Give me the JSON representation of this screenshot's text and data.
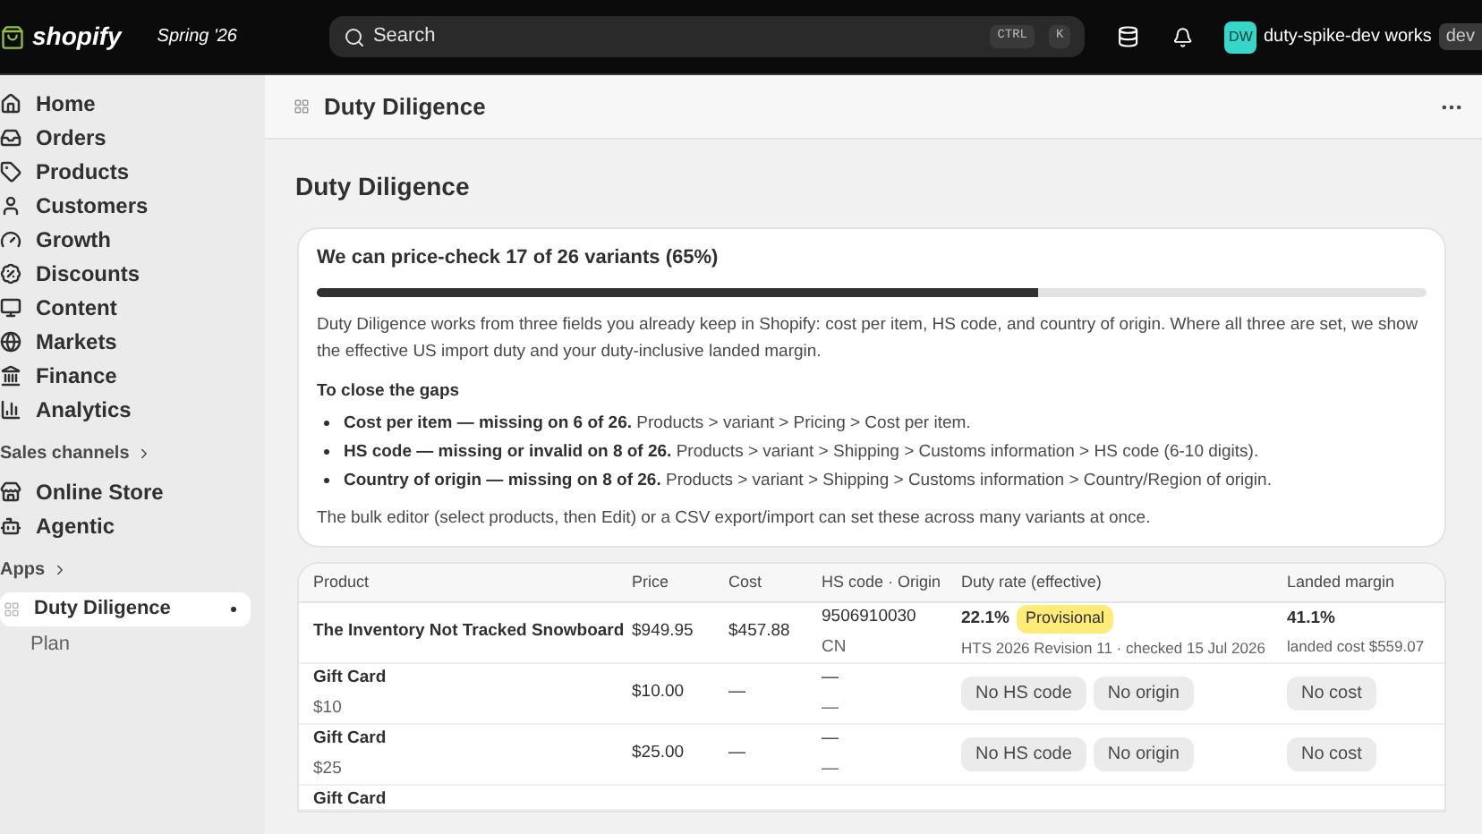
{
  "topbar": {
    "logo": "shopify",
    "edition": "Spring '26",
    "search": {
      "placeholder": "Search",
      "keys": [
        "CTRL",
        "K"
      ]
    },
    "avatar": "DW",
    "store": "duty-spike-dev works",
    "store_badge": "dev"
  },
  "sidebar": {
    "items": [
      {
        "label": "Home"
      },
      {
        "label": "Orders"
      },
      {
        "label": "Products"
      },
      {
        "label": "Customers"
      },
      {
        "label": "Growth"
      },
      {
        "label": "Discounts"
      },
      {
        "label": "Content"
      },
      {
        "label": "Markets"
      },
      {
        "label": "Finance"
      },
      {
        "label": "Analytics"
      }
    ],
    "sections": [
      {
        "label": "Sales channels",
        "items": [
          {
            "label": "Online Store"
          },
          {
            "label": "Agentic"
          }
        ]
      },
      {
        "label": "Apps"
      }
    ],
    "apps": [
      {
        "label": "Duty Diligence",
        "selected": true,
        "children": [
          {
            "label": "Plan",
            "selected": false
          }
        ]
      }
    ]
  },
  "header": {
    "title": "Duty Diligence"
  },
  "page_title": "Duty Diligence",
  "summary": {
    "title": "We can price-check 17 of 26 variants (65%)",
    "level": 0.65,
    "intro": "Duty Diligence works from three fields you already keep in Shopify: cost per item, HS code, and country of origin. Where all three are set, we show the effective US import duty and your duty-inclusive landed margin.",
    "gaps_title": "To close the gaps",
    "gaps": [
      "**Cost per item — missing on 6 of 26.** Products > variant > Pricing > Cost per item.",
      "**HS code — missing or invalid on 8 of 26.** Products > variant > Shipping > Customs information > HS code (6-10 digits).",
      "**Country of origin — missing on 8 of 26.** Products > variant > Shipping > Customs information > Country/Region of origin."
    ],
    "footer": "The bulk editor (select products, then Edit) or a CSV export/import can set these across many variants at once."
  },
  "table": {
    "columns": [
      "Product",
      "Price",
      "Cost",
      "HS code · Origin",
      "Duty rate (effective)",
      "Landed margin"
    ],
    "rows": [
      {
        "product": "The Inventory Not Tracked Snowboard",
        "price": "$949.95",
        "cost": "$457.88",
        "hs": "9506910030",
        "origin": "CN",
        "duty": {
          "rate": "22.1%",
          "badge": "Provisional",
          "note": "HTS 2026 Revision 11 · checked 15 Jul 2026"
        },
        "margin": {
          "value": "41.1%",
          "note": "landed cost $559.07"
        }
      },
      {
        "product": "Gift Card",
        "variant": "$10",
        "price": "$10.00",
        "cost": "—",
        "hs": "—",
        "origin": "—",
        "duty_tags": [
          "No HS code",
          "No origin"
        ],
        "margin_tags": [
          "No cost"
        ]
      },
      {
        "product": "Gift Card",
        "variant": "$25",
        "price": "$25.00",
        "cost": "—",
        "hs": "—",
        "origin": "—",
        "duty_tags": [
          "No HS code",
          "No origin"
        ],
        "margin_tags": [
          "No cost"
        ]
      },
      {
        "product": "Gift Card"
      }
    ]
  }
}
